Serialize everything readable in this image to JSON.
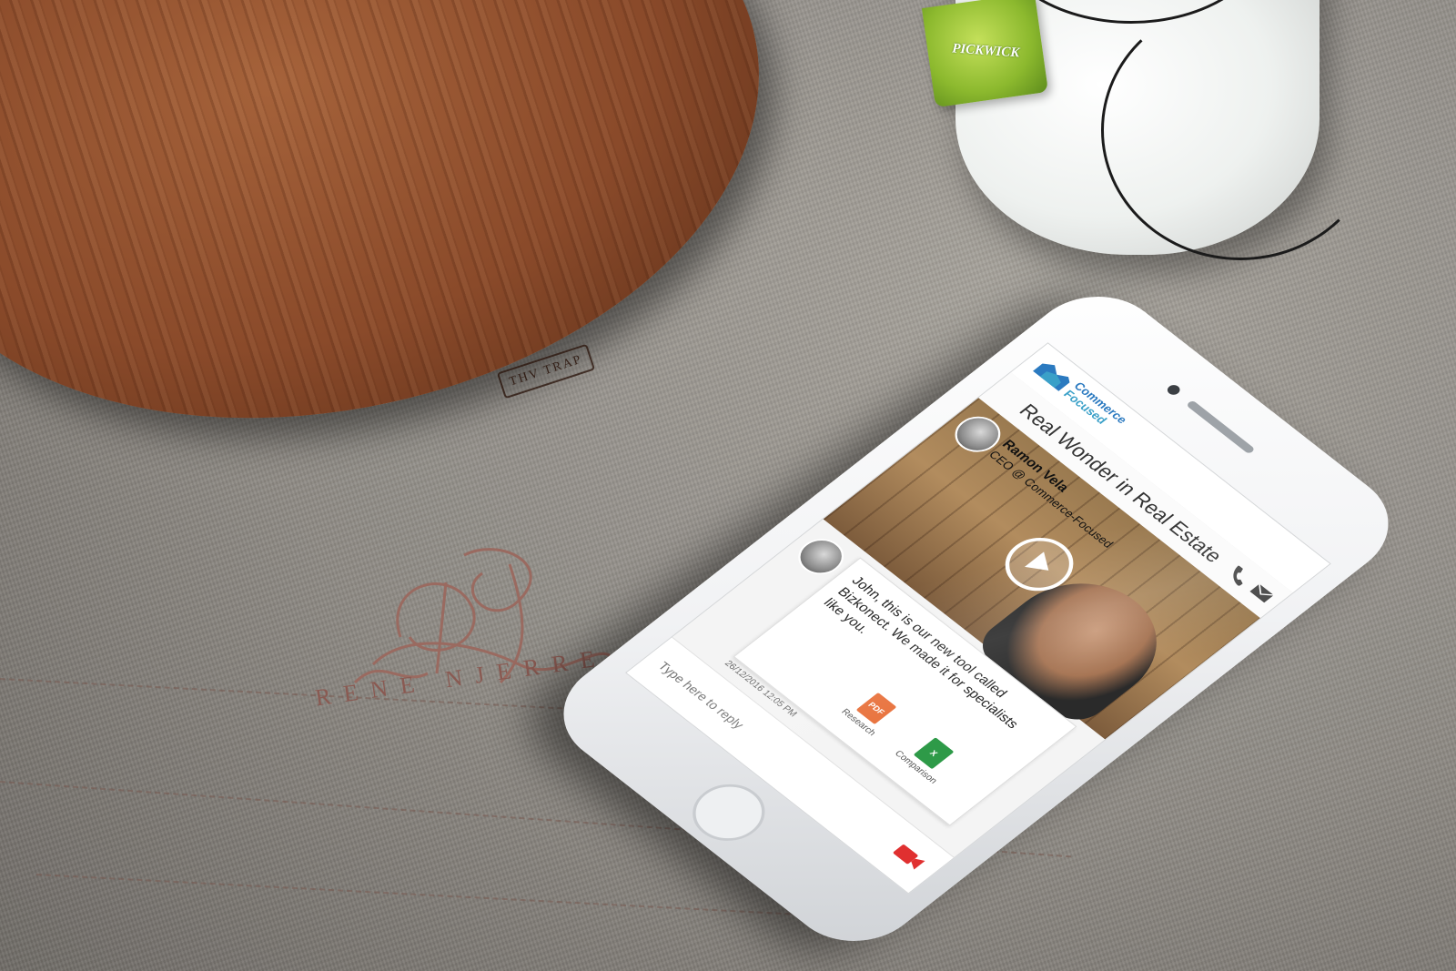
{
  "scene": {
    "board_stamp": "THV TRAP",
    "teabag_brand": "PICKWICK",
    "embroidery_text": "RENE NJERRE"
  },
  "app": {
    "logo_line1": "Commerce",
    "logo_line2": "Focused",
    "title": "Real Wonder in Real Estate",
    "author": {
      "name": "Ramon Vela",
      "role": "CEO @ Commerce-Focused"
    },
    "message": {
      "text": "John, this is our new tool called Bizkonect. We made it for specialists like you.",
      "timestamp": "26/12/2016 12:05 PM",
      "attachments": [
        {
          "label": "Research",
          "type": "PDF",
          "color": "#e8703a"
        },
        {
          "label": "Comparison",
          "type": "X",
          "color": "#2e9a48"
        }
      ]
    },
    "reply": {
      "placeholder": "Type here to reply"
    },
    "colors": {
      "brand_blue": "#2b7ac0",
      "video_red": "#e03030"
    }
  }
}
